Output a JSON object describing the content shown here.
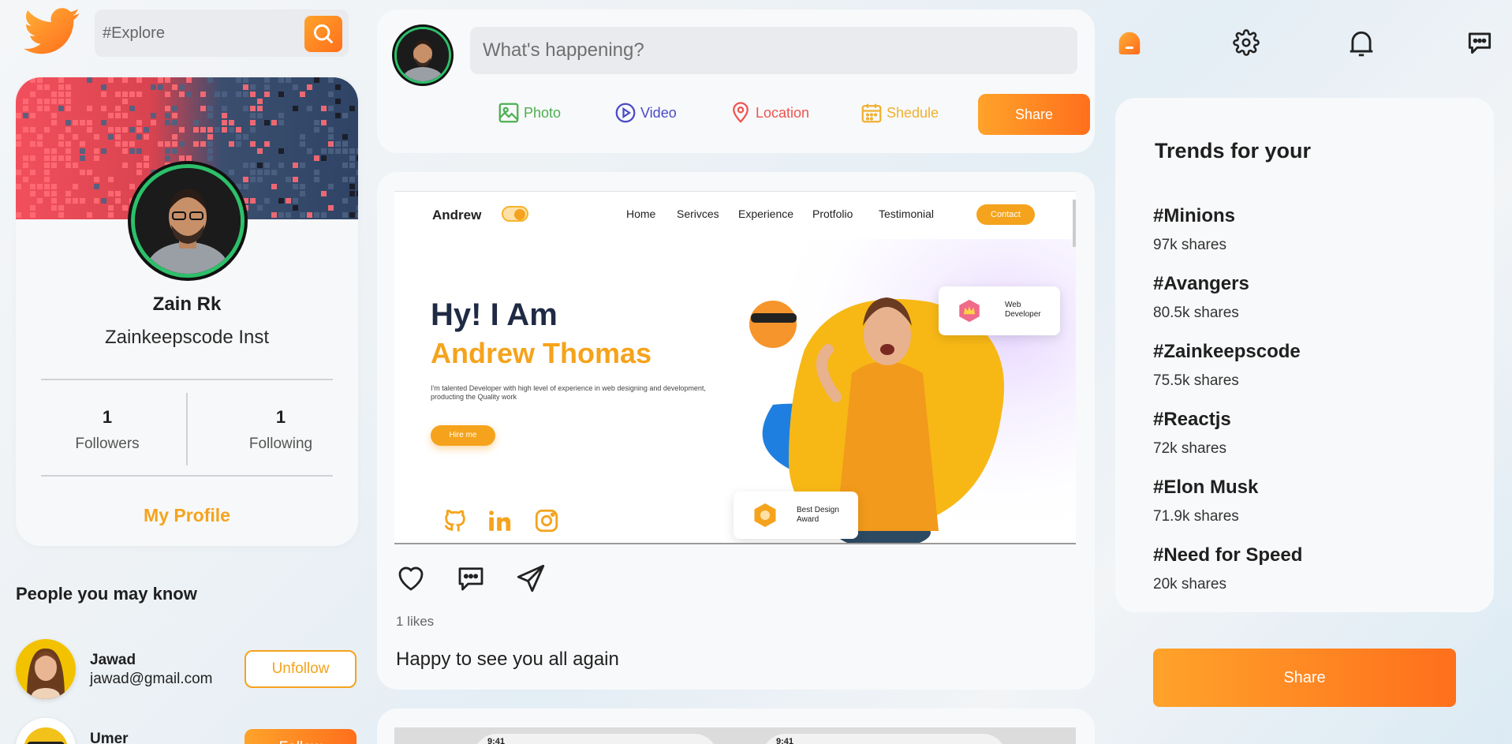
{
  "search": {
    "placeholder": "#Explore"
  },
  "profile": {
    "name": "Zain Rk",
    "handle": "Zainkeepscode Inst",
    "followers_count": "1",
    "followers_label": "Followers",
    "following_count": "1",
    "following_label": "Following",
    "my_profile_label": "My Profile"
  },
  "people": {
    "title": "People you may know",
    "items": [
      {
        "name": "Jawad",
        "email": "jawad@gmail.com",
        "button": "Unfollow"
      },
      {
        "name": "Umer",
        "email": "",
        "button": "Follow"
      }
    ]
  },
  "composer": {
    "placeholder": "What's happening?",
    "options": [
      {
        "label": "Photo",
        "color": "#4caf50",
        "icon": "photo-icon"
      },
      {
        "label": "Video",
        "color": "#4a4ac8",
        "icon": "video-icon"
      },
      {
        "label": "Location",
        "color": "#ef5350",
        "icon": "location-icon"
      },
      {
        "label": "Shedule",
        "color": "#f0b030",
        "icon": "calendar-icon"
      }
    ],
    "share_label": "Share"
  },
  "post": {
    "image": {
      "brand": "Andrew",
      "nav": [
        "Home",
        "Serivces",
        "Experience",
        "Protfolio",
        "Testimonial"
      ],
      "contact": "Contact",
      "hero_line1": "Hy! I Am",
      "hero_line2": "Andrew Thomas",
      "hero_desc": "I'm talented Developer with high level of experience in web designing and development, producting the Quality work",
      "hire": "Hire me",
      "badge1_line1": "Web",
      "badge1_line2": "Developer",
      "badge2_line1": "Best Design",
      "badge2_line2": "Award"
    },
    "likes": "1 likes",
    "caption": "Happy to see you all again"
  },
  "second_post": {
    "time1": "9:41",
    "time2": "9:41"
  },
  "trends": {
    "title": "Trends for your",
    "items": [
      {
        "tag": "#Minions",
        "shares": "97k shares"
      },
      {
        "tag": "#Avangers",
        "shares": "80.5k shares"
      },
      {
        "tag": "#Zainkeepscode",
        "shares": "75.5k shares"
      },
      {
        "tag": "#Reactjs",
        "shares": "72k shares"
      },
      {
        "tag": "#Elon Musk",
        "shares": "71.9k shares"
      },
      {
        "tag": "#Need for Speed",
        "shares": "20k shares"
      }
    ]
  },
  "right_share_label": "Share",
  "colors": {
    "accent": "#f5a31c",
    "accent_gradient_end": "#ff6f1c",
    "twitter_orange": "#ff8a1e"
  }
}
